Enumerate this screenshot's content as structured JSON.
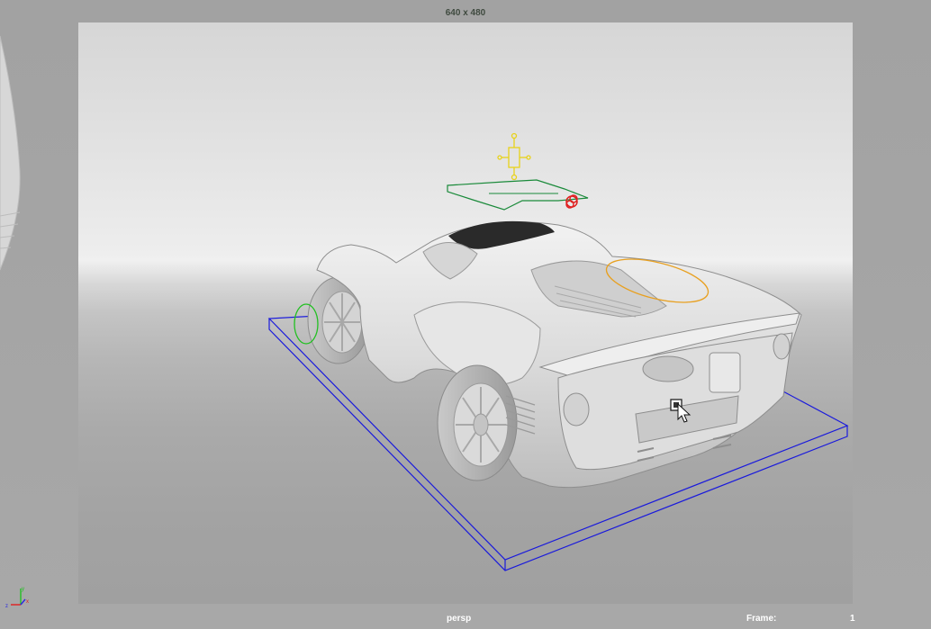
{
  "viewport": {
    "resolution_gate_label": "640 x 480",
    "camera_name": "persp",
    "frame_label": "Frame:",
    "frame_value": "1"
  },
  "colors": {
    "bounding_box": "#1a1adc",
    "light_icon": "#e8d21a",
    "target_manip": "#1a8a3a",
    "red_manip": "#e02020",
    "orange_curve": "#e8a020",
    "green_circle": "#22c022",
    "car_body": "#e2e2e2"
  },
  "icons": {
    "axis": "xyz-axis-icon",
    "cursor": "move-cursor-icon"
  }
}
